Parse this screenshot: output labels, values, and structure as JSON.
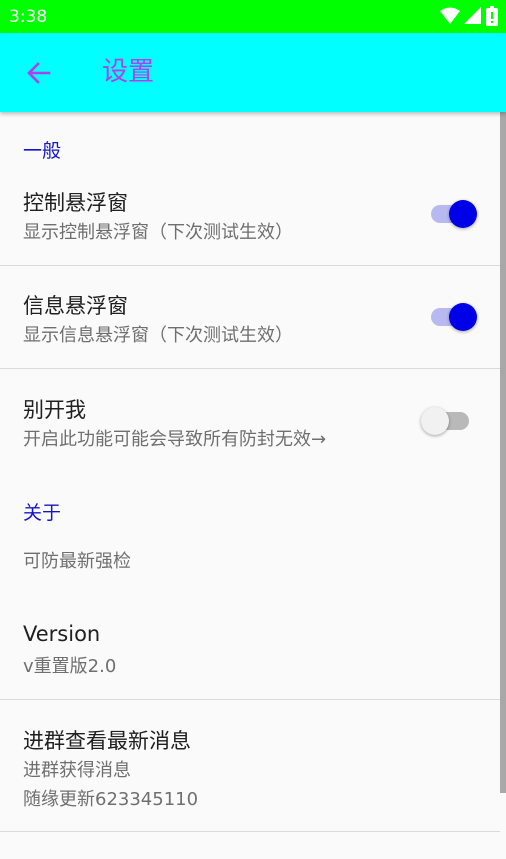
{
  "status_bar": {
    "time": "3:38",
    "icons": [
      "wifi-icon",
      "signal-icon",
      "battery-icon"
    ]
  },
  "app_bar": {
    "title": "设置",
    "back_icon": "arrow-left-icon"
  },
  "categories": {
    "general": "一般",
    "about": "关于"
  },
  "prefs": {
    "control_float": {
      "title": "控制悬浮窗",
      "summary": "显示控制悬浮窗（下次测试生效）",
      "enabled": true
    },
    "info_float": {
      "title": "信息悬浮窗",
      "summary": "显示信息悬浮窗（下次测试生效）",
      "enabled": true
    },
    "dont_open": {
      "title": "别开我",
      "summary": "开启此功能可能会导致所有防封无效→",
      "enabled": false
    },
    "anti_check": {
      "summary": "可防最新强检"
    },
    "version": {
      "title": "Version",
      "summary": "v重置版2.0"
    },
    "group": {
      "title": "进群查看最新消息",
      "summary_line1": "进群获得消息",
      "summary_line2": "随缘更新623345110"
    }
  },
  "colors": {
    "status_bar": "#00ff00",
    "app_bar": "#00ffff",
    "accent": "#b040ee",
    "category": "#1515c8",
    "switch_on": "#0000e8"
  }
}
